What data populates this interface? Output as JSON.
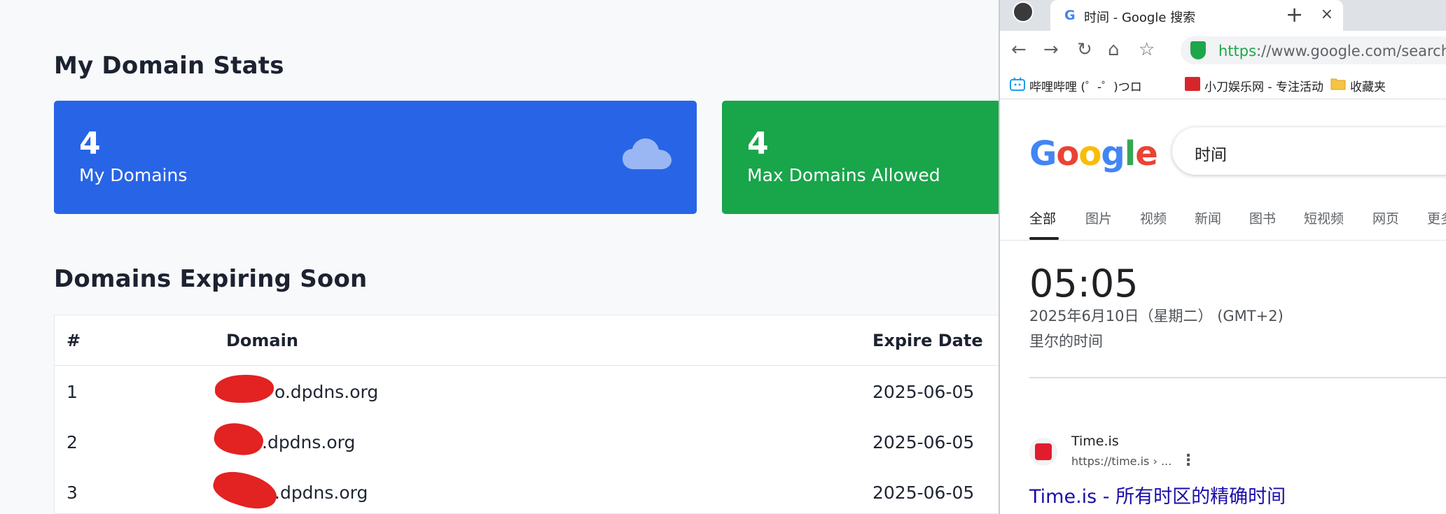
{
  "dashboard": {
    "stats_title": "My Domain Stats",
    "cards": [
      {
        "value": "4",
        "label": "My Domains",
        "color": "#2864e6",
        "icon": "cloud-icon"
      },
      {
        "value": "4",
        "label": "Max Domains Allowed",
        "color": "#19a54a"
      }
    ],
    "expiring_title": "Domains Expiring Soon",
    "table": {
      "headers": [
        "#",
        "Domain",
        "Expire Date"
      ],
      "rows": [
        {
          "num": "1",
          "domain": "o.dpdns.org",
          "expire": "2025-06-05"
        },
        {
          "num": "2",
          "domain": ".dpdns.org",
          "expire": "2025-06-05"
        },
        {
          "num": "3",
          "domain": ".dpdns.org",
          "expire": "2025-06-05"
        }
      ]
    }
  },
  "browser": {
    "tab_title": "时间 - Google 搜索",
    "new_tab": "+",
    "close": "×",
    "url_scheme": "https",
    "url_rest": "://www.google.com/search?q",
    "bookmarks": [
      "哔哩哔哩 (゜-゜)つロ",
      "小刀娱乐网 - 专注活动",
      "收藏夹"
    ],
    "google_logo": [
      "G",
      "o",
      "o",
      "g",
      "l",
      "e"
    ],
    "search_query": "时间",
    "search_tabs": [
      "全部",
      "图片",
      "视频",
      "新闻",
      "图书",
      "短视频",
      "网页",
      "更多"
    ],
    "clock": {
      "time": "05:05",
      "date": "2025年6月10日（星期二） (GMT+2)",
      "place": "里尔的时间"
    },
    "result": {
      "site": "Time.is",
      "url": "https://time.is › ...",
      "title": "Time.is - 所有时区的精确时间"
    }
  }
}
